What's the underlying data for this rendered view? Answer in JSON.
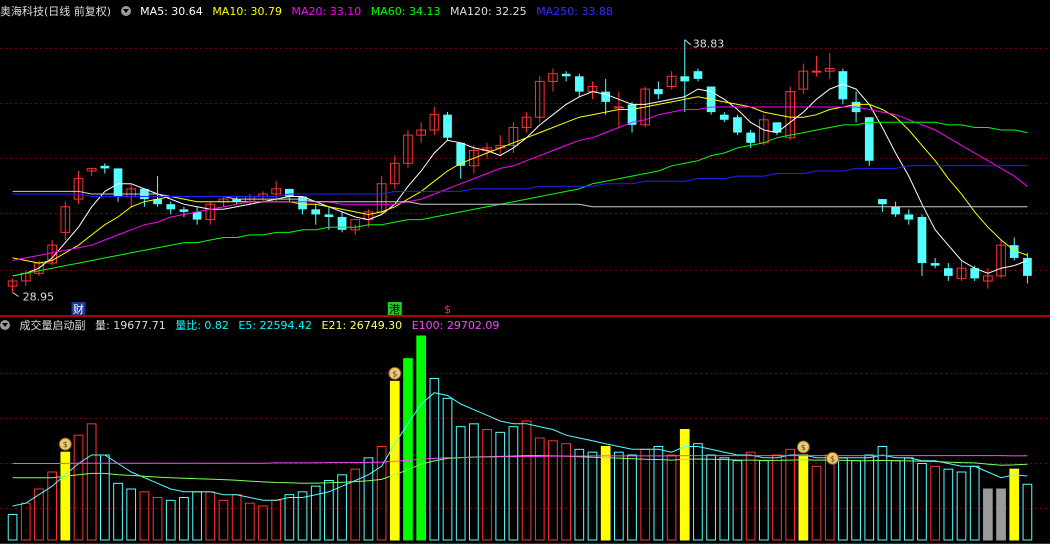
{
  "header": {
    "title": "奥海科技(日线 前复权)",
    "ma": [
      {
        "label": "MA5: 30.64",
        "color": "#ffffff"
      },
      {
        "label": "MA10: 30.79",
        "color": "#ffff00"
      },
      {
        "label": "MA20: 33.10",
        "color": "#ff00ff"
      },
      {
        "label": "MA60: 34.13",
        "color": "#00ff00"
      },
      {
        "label": "MA120: 32.25",
        "color": "#dddddd"
      },
      {
        "label": "MA250: 33.88",
        "color": "#0000ff"
      }
    ]
  },
  "volume_header": {
    "title": "成交量启动副",
    "items": [
      {
        "label": "量: 19677.71",
        "color": "#dddddd"
      },
      {
        "label": "量比: 0.82",
        "color": "#00ffff"
      },
      {
        "label": "E5: 22594.42",
        "color": "#00ffff"
      },
      {
        "label": "E21: 26749.30",
        "color": "#ffff66"
      },
      {
        "label": "E100: 29702.09",
        "color": "#ff44ff"
      }
    ]
  },
  "annotations": {
    "high": "38.83",
    "low": "28.95",
    "markers": [
      "财",
      "港",
      "$"
    ]
  },
  "colors": {
    "up": "#ff3232",
    "down": "#54ffff",
    "grid": "#7a0000",
    "signal_yellow": "#ffff00",
    "signal_green": "#00ff00",
    "grey": "#9a9a9a"
  },
  "chart_data": {
    "type": "candlestick",
    "candles": [
      [
        29.2,
        29.5,
        28.95,
        29.4
      ],
      [
        29.4,
        29.8,
        29.2,
        29.7
      ],
      [
        29.7,
        30.2,
        29.6,
        30.1
      ],
      [
        30.1,
        31.0,
        30.0,
        30.8
      ],
      [
        31.3,
        32.5,
        31.0,
        32.3
      ],
      [
        32.6,
        33.7,
        32.4,
        33.4
      ],
      [
        33.7,
        33.8,
        33.5,
        33.8
      ],
      [
        33.9,
        34.0,
        33.6,
        33.8
      ],
      [
        33.8,
        33.6,
        32.5,
        32.7
      ],
      [
        32.7,
        33.2,
        32.3,
        33.0
      ],
      [
        33.0,
        33.0,
        32.3,
        32.6
      ],
      [
        32.6,
        33.5,
        32.3,
        32.4
      ],
      [
        32.4,
        32.5,
        32.0,
        32.2
      ],
      [
        32.2,
        32.3,
        31.9,
        32.1
      ],
      [
        32.1,
        32.3,
        31.6,
        31.8
      ],
      [
        31.8,
        32.5,
        31.6,
        32.4
      ],
      [
        32.5,
        32.7,
        32.3,
        32.6
      ],
      [
        32.6,
        32.7,
        32.4,
        32.5
      ],
      [
        32.5,
        32.8,
        32.4,
        32.7
      ],
      [
        32.7,
        32.9,
        32.5,
        32.8
      ],
      [
        32.8,
        33.3,
        32.5,
        33.0
      ],
      [
        33.0,
        33.0,
        32.5,
        32.7
      ],
      [
        32.7,
        32.6,
        32.0,
        32.2
      ],
      [
        32.2,
        32.4,
        31.6,
        32.0
      ],
      [
        32.0,
        32.3,
        31.4,
        31.9
      ],
      [
        31.9,
        32.1,
        31.3,
        31.4
      ],
      [
        31.4,
        31.6,
        31.2,
        31.8
      ],
      [
        31.8,
        32.2,
        31.5,
        32.1
      ],
      [
        32.1,
        33.5,
        32.0,
        33.2
      ],
      [
        33.2,
        34.3,
        33.0,
        34.0
      ],
      [
        34.0,
        35.3,
        33.8,
        35.1
      ],
      [
        35.1,
        35.6,
        34.8,
        35.3
      ],
      [
        35.3,
        36.2,
        35.1,
        35.9
      ],
      [
        35.9,
        36.0,
        34.9,
        35.0
      ],
      [
        34.8,
        34.8,
        33.4,
        33.9
      ],
      [
        33.9,
        34.7,
        33.6,
        34.5
      ],
      [
        34.5,
        34.8,
        34.2,
        34.6
      ],
      [
        34.6,
        35.1,
        34.3,
        34.7
      ],
      [
        34.7,
        35.6,
        34.4,
        35.4
      ],
      [
        35.4,
        36.0,
        35.2,
        35.8
      ],
      [
        35.8,
        37.4,
        35.6,
        37.2
      ],
      [
        37.2,
        37.7,
        36.8,
        37.5
      ],
      [
        37.5,
        37.6,
        37.2,
        37.4
      ],
      [
        37.4,
        37.5,
        36.6,
        36.8
      ],
      [
        36.8,
        37.2,
        36.5,
        37.0
      ],
      [
        36.8,
        37.3,
        35.9,
        36.4
      ],
      [
        36.2,
        36.8,
        35.4,
        36.2
      ],
      [
        36.3,
        36.4,
        35.2,
        35.5
      ],
      [
        35.5,
        37.0,
        35.4,
        36.9
      ],
      [
        36.9,
        37.2,
        36.5,
        36.7
      ],
      [
        37.0,
        37.6,
        36.9,
        37.4
      ],
      [
        37.4,
        38.83,
        36.0,
        37.2
      ],
      [
        37.6,
        37.7,
        37.2,
        37.3
      ],
      [
        37.0,
        37.0,
        35.9,
        36.0
      ],
      [
        35.9,
        36.0,
        35.6,
        35.7
      ],
      [
        35.8,
        35.9,
        35.1,
        35.2
      ],
      [
        35.2,
        35.3,
        34.6,
        34.8
      ],
      [
        34.8,
        35.9,
        34.7,
        35.7
      ],
      [
        35.6,
        35.6,
        35.1,
        35.2
      ],
      [
        35.0,
        37.0,
        34.9,
        36.8
      ],
      [
        36.9,
        37.9,
        36.7,
        37.6
      ],
      [
        37.6,
        38.2,
        37.4,
        37.6
      ],
      [
        37.6,
        38.3,
        37.3,
        37.7
      ],
      [
        37.6,
        37.7,
        36.3,
        36.5
      ],
      [
        36.4,
        36.8,
        35.6,
        36.0
      ],
      [
        35.8,
        35.8,
        33.9,
        34.1
      ],
      [
        32.6,
        32.6,
        32.1,
        32.4
      ],
      [
        32.3,
        32.5,
        31.9,
        32.0
      ],
      [
        32.0,
        32.2,
        31.6,
        31.8
      ],
      [
        31.9,
        32.0,
        29.6,
        30.1
      ],
      [
        30.1,
        30.3,
        29.9,
        30.0
      ],
      [
        29.9,
        30.1,
        29.4,
        29.6
      ],
      [
        29.5,
        30.2,
        29.4,
        29.9
      ],
      [
        29.9,
        30.0,
        29.4,
        29.5
      ],
      [
        29.4,
        29.9,
        29.1,
        29.6
      ],
      [
        29.6,
        31.0,
        29.5,
        30.8
      ],
      [
        30.8,
        31.1,
        30.2,
        30.3
      ],
      [
        30.3,
        30.5,
        29.3,
        29.6
      ]
    ],
    "ma_lines": {
      "MA5": [
        29.6,
        29.7,
        29.9,
        30.3,
        30.9,
        31.5,
        32.3,
        32.9,
        33.2,
        33.2,
        33.0,
        32.8,
        32.6,
        32.4,
        32.3,
        32.2,
        32.2,
        32.3,
        32.4,
        32.5,
        32.6,
        32.7,
        32.7,
        32.5,
        32.3,
        32.1,
        31.9,
        31.8,
        32.0,
        32.4,
        33.1,
        33.7,
        34.4,
        34.9,
        34.8,
        34.6,
        34.5,
        34.3,
        34.6,
        35.0,
        35.5,
        35.9,
        36.3,
        36.6,
        36.8,
        36.7,
        36.5,
        36.3,
        36.3,
        36.4,
        36.5,
        36.6,
        36.9,
        36.8,
        36.5,
        36.1,
        35.6,
        35.3,
        35.2,
        35.6,
        36.0,
        36.5,
        36.9,
        37.1,
        36.9,
        36.3,
        35.4,
        34.4,
        33.5,
        32.4,
        31.4,
        30.8,
        30.2,
        29.9,
        29.7,
        29.9,
        30.0,
        30.2
      ],
      "MA10": [
        30.3,
        30.2,
        30.1,
        30.2,
        30.5,
        30.8,
        31.2,
        31.6,
        31.9,
        32.3,
        32.5,
        32.6,
        32.7,
        32.6,
        32.5,
        32.5,
        32.5,
        32.5,
        32.5,
        32.5,
        32.5,
        32.5,
        32.4,
        32.4,
        32.3,
        32.2,
        32.1,
        32.0,
        32.1,
        32.3,
        32.6,
        32.9,
        33.3,
        33.7,
        34.0,
        34.2,
        34.4,
        34.6,
        34.8,
        35.0,
        35.2,
        35.4,
        35.6,
        35.8,
        35.9,
        36.0,
        36.1,
        36.1,
        36.2,
        36.3,
        36.4,
        36.5,
        36.6,
        36.5,
        36.4,
        36.3,
        36.2,
        36.0,
        35.9,
        35.8,
        35.8,
        35.9,
        36.1,
        36.2,
        36.3,
        36.3,
        36.1,
        35.8,
        35.3,
        34.7,
        34.1,
        33.4,
        32.8,
        32.1,
        31.5,
        31.0,
        30.6,
        30.4
      ],
      "MA20": [
        30.2,
        30.3,
        30.4,
        30.5,
        30.6,
        30.7,
        30.8,
        31.0,
        31.2,
        31.4,
        31.6,
        31.7,
        31.9,
        32.0,
        32.1,
        32.2,
        32.3,
        32.4,
        32.5,
        32.5,
        32.5,
        32.5,
        32.5,
        32.5,
        32.5,
        32.4,
        32.4,
        32.4,
        32.4,
        32.4,
        32.5,
        32.6,
        32.8,
        33.0,
        33.2,
        33.4,
        33.6,
        33.8,
        33.9,
        34.1,
        34.3,
        34.5,
        34.7,
        34.9,
        35.0,
        35.2,
        35.4,
        35.6,
        35.7,
        35.9,
        36.0,
        36.1,
        36.1,
        36.2,
        36.2,
        36.2,
        36.2,
        36.2,
        36.2,
        36.2,
        36.2,
        36.2,
        36.2,
        36.2,
        36.2,
        36.1,
        36.0,
        35.9,
        35.7,
        35.5,
        35.3,
        35.0,
        34.7,
        34.4,
        34.1,
        33.8,
        33.5,
        33.1
      ],
      "MA60": [
        29.6,
        29.7,
        29.8,
        29.9,
        30.0,
        30.1,
        30.2,
        30.3,
        30.4,
        30.5,
        30.6,
        30.7,
        30.8,
        30.9,
        30.9,
        31.0,
        31.1,
        31.1,
        31.2,
        31.2,
        31.3,
        31.3,
        31.4,
        31.4,
        31.5,
        31.5,
        31.5,
        31.6,
        31.6,
        31.7,
        31.8,
        31.8,
        31.9,
        32.0,
        32.1,
        32.2,
        32.3,
        32.4,
        32.5,
        32.6,
        32.7,
        32.8,
        32.9,
        33.0,
        33.2,
        33.3,
        33.4,
        33.5,
        33.6,
        33.7,
        33.9,
        34.0,
        34.1,
        34.3,
        34.4,
        34.6,
        34.7,
        34.8,
        35.0,
        35.1,
        35.2,
        35.3,
        35.4,
        35.5,
        35.5,
        35.6,
        35.6,
        35.6,
        35.6,
        35.6,
        35.6,
        35.5,
        35.5,
        35.4,
        35.4,
        35.3,
        35.3,
        35.2
      ],
      "MA120": [
        32.9,
        32.9,
        32.9,
        32.9,
        32.9,
        32.9,
        32.8,
        32.8,
        32.8,
        32.8,
        32.8,
        32.8,
        32.7,
        32.7,
        32.7,
        32.7,
        32.7,
        32.6,
        32.6,
        32.6,
        32.6,
        32.6,
        32.6,
        32.5,
        32.5,
        32.5,
        32.5,
        32.5,
        32.5,
        32.5,
        32.5,
        32.4,
        32.4,
        32.4,
        32.4,
        32.4,
        32.4,
        32.4,
        32.4,
        32.4,
        32.4,
        32.4,
        32.4,
        32.4,
        32.3,
        32.3,
        32.3,
        32.3,
        32.3,
        32.3,
        32.3,
        32.3,
        32.3,
        32.3,
        32.3,
        32.3,
        32.3,
        32.3,
        32.3,
        32.3,
        32.3,
        32.3,
        32.3,
        32.3,
        32.3,
        32.3,
        32.3,
        32.3,
        32.3,
        32.3,
        32.3,
        32.3,
        32.3,
        32.3,
        32.3,
        32.3,
        32.3,
        32.3
      ],
      "MA250": [
        32.8,
        32.8,
        32.8,
        32.8,
        32.8,
        32.8,
        32.7,
        32.7,
        32.7,
        32.7,
        32.7,
        32.7,
        32.7,
        32.7,
        32.7,
        32.7,
        32.7,
        32.7,
        32.7,
        32.7,
        32.7,
        32.8,
        32.8,
        32.8,
        32.8,
        32.8,
        32.8,
        32.8,
        32.8,
        32.9,
        32.9,
        32.9,
        32.9,
        32.9,
        32.9,
        33.0,
        33.0,
        33.0,
        33.0,
        33.0,
        33.1,
        33.1,
        33.1,
        33.1,
        33.1,
        33.2,
        33.2,
        33.2,
        33.3,
        33.3,
        33.3,
        33.3,
        33.4,
        33.4,
        33.4,
        33.5,
        33.5,
        33.5,
        33.6,
        33.6,
        33.6,
        33.7,
        33.7,
        33.7,
        33.8,
        33.8,
        33.8,
        33.8,
        33.9,
        33.9,
        33.9,
        33.9,
        33.9,
        33.9,
        33.9,
        33.9,
        33.9,
        33.9
      ]
    },
    "volume": [
      9000,
      13000,
      18000,
      24000,
      31000,
      37000,
      41000,
      30000,
      20000,
      18000,
      17000,
      15000,
      14000,
      15000,
      17000,
      17000,
      14000,
      16000,
      13000,
      12000,
      14000,
      16000,
      17000,
      19000,
      21000,
      23000,
      25000,
      29000,
      33000,
      56000,
      64000,
      72000,
      57000,
      50000,
      40000,
      41000,
      39000,
      38000,
      40000,
      42000,
      36000,
      35000,
      34000,
      32000,
      31000,
      33000,
      31000,
      30000,
      32000,
      33000,
      30000,
      39000,
      34000,
      30000,
      29000,
      28000,
      31000,
      28000,
      30000,
      32000,
      30000,
      26000,
      30000,
      29000,
      28000,
      30000,
      33000,
      28000,
      29000,
      27000,
      26000,
      25000,
      24000,
      26000,
      18000,
      18000,
      25000,
      19677
    ],
    "volume_type": [
      "down",
      "up",
      "up",
      "up",
      "sig_y",
      "up",
      "up",
      "down",
      "down",
      "down",
      "up",
      "up",
      "down",
      "down",
      "down",
      "up",
      "up",
      "up",
      "up",
      "up",
      "up",
      "down",
      "down",
      "down",
      "down",
      "down",
      "up",
      "down",
      "up",
      "sig_y",
      "sig_g",
      "sig_g",
      "down",
      "down",
      "down",
      "down",
      "up",
      "down",
      "down",
      "up",
      "up",
      "up",
      "up",
      "down",
      "down",
      "sig_y",
      "down",
      "down",
      "up",
      "down",
      "up",
      "sig_y",
      "down",
      "down",
      "down",
      "down",
      "up",
      "down",
      "up",
      "up",
      "sig_y",
      "up",
      "up",
      "down",
      "down",
      "down",
      "down",
      "down",
      "down",
      "down",
      "up",
      "down",
      "down",
      "down",
      "grey",
      "grey",
      "sig_y",
      "down"
    ],
    "vol_E5": [
      12000,
      13000,
      16000,
      19000,
      23000,
      27000,
      30000,
      30000,
      27000,
      24000,
      22000,
      20000,
      18000,
      17000,
      17000,
      17000,
      16000,
      16000,
      15000,
      14000,
      14000,
      15000,
      15000,
      16000,
      17000,
      19000,
      21000,
      23000,
      26000,
      34000,
      41000,
      48000,
      52000,
      51000,
      48000,
      46000,
      44000,
      42000,
      41000,
      41000,
      40000,
      39000,
      37000,
      36000,
      35000,
      34000,
      33000,
      32000,
      32000,
      32000,
      31000,
      33000,
      33000,
      32000,
      31000,
      30000,
      30000,
      29000,
      29000,
      30000,
      30000,
      29000,
      29000,
      29000,
      29000,
      29000,
      30000,
      29000,
      29000,
      28000,
      28000,
      27000,
      26000,
      26000,
      24000,
      22000,
      23000,
      22594
    ],
    "vol_E21": [
      22000,
      22000,
      22000,
      22000,
      22500,
      23000,
      23500,
      23500,
      23000,
      22800,
      22500,
      22200,
      22000,
      21800,
      21600,
      21500,
      21300,
      21100,
      20800,
      20500,
      20300,
      20200,
      20000,
      20100,
      20200,
      20400,
      20600,
      20900,
      21400,
      23000,
      24800,
      26800,
      27900,
      28800,
      29000,
      29300,
      29400,
      29500,
      29600,
      29800,
      29800,
      29700,
      29600,
      29400,
      29200,
      29100,
      28900,
      28700,
      28500,
      28400,
      28200,
      28500,
      28600,
      28500,
      28400,
      28200,
      28200,
      28100,
      28100,
      28200,
      28300,
      28200,
      28200,
      28100,
      28000,
      28000,
      28100,
      28000,
      27900,
      27800,
      27700,
      27500,
      27300,
      27200,
      26800,
      26400,
      26500,
      26749
    ],
    "vol_E100": [
      27000,
      27000,
      27000,
      27000,
      27000,
      27100,
      27100,
      27100,
      27100,
      27100,
      27100,
      27100,
      27100,
      27100,
      27100,
      27100,
      27100,
      27100,
      27100,
      27100,
      27200,
      27200,
      27200,
      27200,
      27300,
      27300,
      27300,
      27400,
      27500,
      27800,
      28100,
      28500,
      28800,
      29000,
      29100,
      29200,
      29300,
      29400,
      29400,
      29500,
      29500,
      29600,
      29600,
      29600,
      29700,
      29700,
      29700,
      29700,
      29700,
      29700,
      29700,
      29800,
      29800,
      29800,
      29800,
      29800,
      29800,
      29800,
      29800,
      29800,
      29800,
      29800,
      29800,
      29800,
      29800,
      29800,
      29800,
      29800,
      29800,
      29800,
      29800,
      29800,
      29800,
      29800,
      29800,
      29800,
      29700,
      29702
    ],
    "price_range": [
      28.5,
      39.6
    ],
    "volume_max": 72000,
    "grid": true
  }
}
